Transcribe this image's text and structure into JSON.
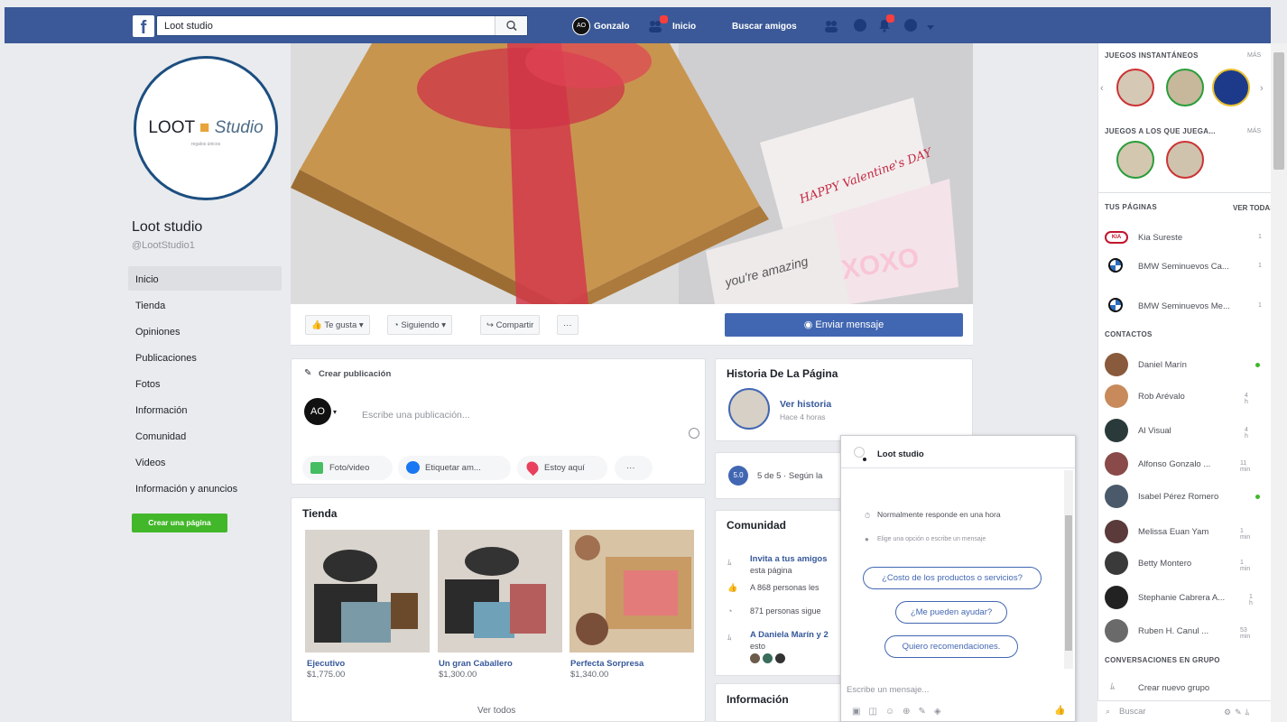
{
  "header": {
    "logo": "f",
    "search_value": "Loot studio",
    "user_name": "Gonzalo",
    "user_initials": "AO",
    "nav_home": "Inicio",
    "nav_find_friends": "Buscar amigos"
  },
  "page": {
    "name": "Loot studio",
    "handle": "@LootStudio1",
    "logo_main": "LOOT",
    "logo_studio": "Studio",
    "logo_tagline": "regalos únicos"
  },
  "left_nav": [
    "Inicio",
    "Tienda",
    "Opiniones",
    "Publicaciones",
    "Fotos",
    "Información",
    "Comunidad",
    "Videos",
    "Información y anuncios"
  ],
  "create_page": "Crear una página",
  "cover": {
    "card_text": "HAPPY Valentine's DAY",
    "card_text2": "XOXO",
    "card_text3": "you're amazing"
  },
  "actions": {
    "like": "Te gusta",
    "following": "Siguiendo",
    "share": "Compartir",
    "more": "···",
    "send_message": "Enviar mensaje"
  },
  "composer": {
    "title": "Crear publicación",
    "placeholder": "Escribe una publicación...",
    "photo_video": "Foto/video",
    "tag_friends": "Etiquetar am...",
    "check_in": "Estoy aquí",
    "more": "···"
  },
  "shop": {
    "title": "Tienda",
    "items": [
      {
        "name": "Ejecutivo",
        "price": "$1,775.00"
      },
      {
        "name": "Un gran Caballero",
        "price": "$1,300.00"
      },
      {
        "name": "Perfecta Sorpresa",
        "price": "$1,340.00"
      }
    ],
    "see_all": "Ver todos"
  },
  "story": {
    "title": "Historia De La Página",
    "link": "Ver historia",
    "time": "Hace 4 horas"
  },
  "rating": {
    "score": "5.0",
    "text": "5 de 5 · Según la"
  },
  "community": {
    "title": "Comunidad",
    "invite": "Invita a tus amigos",
    "invite2": "esta página",
    "likes": "A 868 personas les",
    "follows": "871 personas sigue",
    "friends": "A Daniela Marín y 2",
    "friends2": "esto"
  },
  "info": {
    "title": "Información"
  },
  "chat": {
    "title": "Loot studio",
    "responds": "Normalmente responde en una hora",
    "hint": "Elige una opción o escribe un mensaje",
    "options": [
      "¿Costo de los productos o servicios?",
      "¿Me pueden ayudar?",
      "Quiero recomendaciones."
    ],
    "input_placeholder": "Escribe un mensaje..."
  },
  "sidebar": {
    "instant_games": "JUEGOS INSTANTÁNEOS",
    "instant_more": "MÁS",
    "games_played": "JUEGOS A LOS QUE JUEGA...",
    "games_more": "MÁS",
    "your_pages": "TUS PÁGINAS",
    "see_all": "VER TODAS",
    "pages": [
      {
        "name": "Kia Sureste",
        "count": "1",
        "logo": "KIA"
      },
      {
        "name": "BMW Seminuevos Ca...",
        "count": "1"
      },
      {
        "name": "BMW Seminuevos Me...",
        "count": "1"
      }
    ],
    "contacts_title": "CONTACTOS",
    "contacts": [
      {
        "name": "Daniel Marín",
        "status": ""
      },
      {
        "name": "Rob Arévalo",
        "status": "4 h"
      },
      {
        "name": "Al Visual",
        "status": "4 h"
      },
      {
        "name": "Alfonso Gonzalo ...",
        "status": "11 min"
      },
      {
        "name": "Isabel Pérez Romero",
        "status": ""
      },
      {
        "name": "Melissa Euan Yam",
        "status": "1 min"
      },
      {
        "name": "Betty Montero",
        "status": "1 min"
      },
      {
        "name": "Stephanie Cabrera A...",
        "status": "1 h"
      },
      {
        "name": "Ruben H. Canul ...",
        "status": "53 min"
      }
    ],
    "group_conv": "CONVERSACIONES EN GRUPO",
    "create_group": "Crear nuevo grupo",
    "search": "Buscar"
  }
}
